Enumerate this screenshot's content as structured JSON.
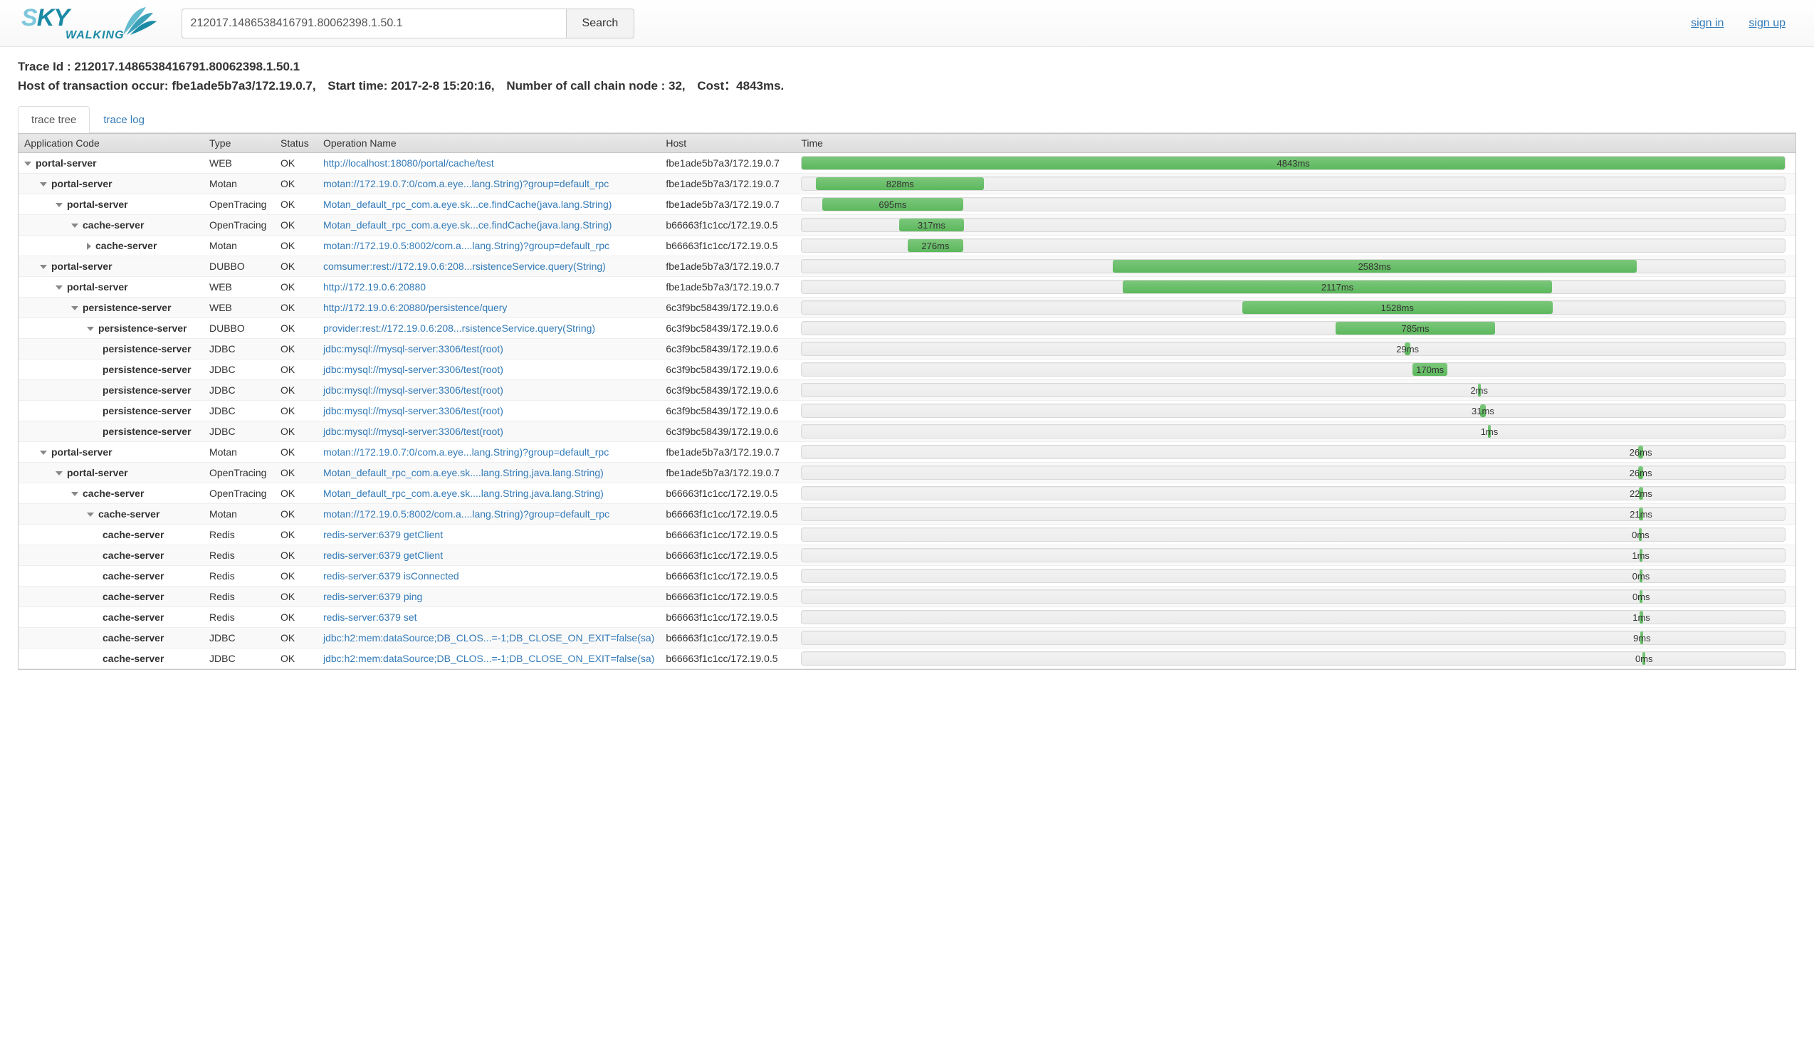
{
  "logo": {
    "main": "SKY",
    "sub": "WALKING"
  },
  "search": {
    "value": "212017.1486538416791.80062398.1.50.1",
    "button": "Search"
  },
  "toplinks": {
    "signin": "sign in",
    "signup": "sign up"
  },
  "meta": {
    "trace_label": "Trace Id : ",
    "trace_id": "212017.1486538416791.80062398.1.50.1",
    "host_label": "Host of transaction occur: ",
    "host": "fbe1ade5b7a3/172.19.0.7,",
    "start_label": "Start time: ",
    "start": "2017-2-8 15:20:16,",
    "nodes_label": "Number of call chain node : ",
    "nodes": "32,",
    "cost_label": "Cost：",
    "cost": "4843ms."
  },
  "tabs": {
    "tree": "trace tree",
    "log": "trace log"
  },
  "columns": {
    "app": "Application Code",
    "type": "Type",
    "status": "Status",
    "op": "Operation Name",
    "host": "Host",
    "time": "Time"
  },
  "total_ms": 4843,
  "rows": [
    {
      "indent": 0,
      "caret": "down",
      "app": "portal-server",
      "type": "WEB",
      "status": "OK",
      "op": "http://localhost:18080/portal/cache/test",
      "host": "fbe1ade5b7a3/172.19.0.7",
      "offset": 0,
      "dur": 4843
    },
    {
      "indent": 1,
      "caret": "down",
      "app": "portal-server",
      "type": "Motan",
      "status": "OK",
      "op": "motan://172.19.0.7:0/com.a.eye...lang.String)?group=default_rpc",
      "host": "fbe1ade5b7a3/172.19.0.7",
      "offset": 70,
      "dur": 828
    },
    {
      "indent": 2,
      "caret": "down",
      "app": "portal-server",
      "type": "OpenTracing",
      "status": "OK",
      "op": "Motan_default_rpc_com.a.eye.sk...ce.findCache(java.lang.String)",
      "host": "fbe1ade5b7a3/172.19.0.7",
      "offset": 100,
      "dur": 695
    },
    {
      "indent": 3,
      "caret": "down",
      "app": "cache-server",
      "type": "OpenTracing",
      "status": "OK",
      "op": "Motan_default_rpc_com.a.eye.sk...ce.findCache(java.lang.String)",
      "host": "b66663f1c1cc/172.19.0.5",
      "offset": 480,
      "dur": 317
    },
    {
      "indent": 4,
      "caret": "right",
      "app": "cache-server",
      "type": "Motan",
      "status": "OK",
      "op": "motan://172.19.0.5:8002/com.a....lang.String)?group=default_rpc",
      "host": "b66663f1c1cc/172.19.0.5",
      "offset": 520,
      "dur": 276
    },
    {
      "indent": 1,
      "caret": "down",
      "app": "portal-server",
      "type": "DUBBO",
      "status": "OK",
      "op": "comsumer:rest://172.19.0.6:208...rsistenceService.query(String)",
      "host": "fbe1ade5b7a3/172.19.0.7",
      "offset": 1530,
      "dur": 2583
    },
    {
      "indent": 2,
      "caret": "down",
      "app": "portal-server",
      "type": "WEB",
      "status": "OK",
      "op": "http://172.19.0.6:20880",
      "host": "fbe1ade5b7a3/172.19.0.7",
      "offset": 1580,
      "dur": 2117
    },
    {
      "indent": 3,
      "caret": "down",
      "app": "persistence-server",
      "type": "WEB",
      "status": "OK",
      "op": "http://172.19.0.6:20880/persistence/query",
      "host": "6c3f9bc58439/172.19.0.6",
      "offset": 2170,
      "dur": 1528
    },
    {
      "indent": 4,
      "caret": "down",
      "app": "persistence-server",
      "type": "DUBBO",
      "status": "OK",
      "op": "provider:rest://172.19.0.6:208...rsistenceService.query(String)",
      "host": "6c3f9bc58439/172.19.0.6",
      "offset": 2630,
      "dur": 785
    },
    {
      "indent": 5,
      "caret": "",
      "app": "persistence-server",
      "type": "JDBC",
      "status": "OK",
      "op": "jdbc:mysql://mysql-server:3306/test(root)",
      "host": "6c3f9bc58439/172.19.0.6",
      "offset": 2970,
      "dur": 29
    },
    {
      "indent": 5,
      "caret": "",
      "app": "persistence-server",
      "type": "JDBC",
      "status": "OK",
      "op": "jdbc:mysql://mysql-server:3306/test(root)",
      "host": "6c3f9bc58439/172.19.0.6",
      "offset": 3010,
      "dur": 170
    },
    {
      "indent": 5,
      "caret": "",
      "app": "persistence-server",
      "type": "JDBC",
      "status": "OK",
      "op": "jdbc:mysql://mysql-server:3306/test(root)",
      "host": "6c3f9bc58439/172.19.0.6",
      "offset": 3330,
      "dur": 2
    },
    {
      "indent": 5,
      "caret": "",
      "app": "persistence-server",
      "type": "JDBC",
      "status": "OK",
      "op": "jdbc:mysql://mysql-server:3306/test(root)",
      "host": "6c3f9bc58439/172.19.0.6",
      "offset": 3340,
      "dur": 31
    },
    {
      "indent": 5,
      "caret": "",
      "app": "persistence-server",
      "type": "JDBC",
      "status": "OK",
      "op": "jdbc:mysql://mysql-server:3306/test(root)",
      "host": "6c3f9bc58439/172.19.0.6",
      "offset": 3380,
      "dur": 1
    },
    {
      "indent": 1,
      "caret": "down",
      "app": "portal-server",
      "type": "Motan",
      "status": "OK",
      "op": "motan://172.19.0.7:0/com.a.eye...lang.String)?group=default_rpc",
      "host": "fbe1ade5b7a3/172.19.0.7",
      "offset": 4120,
      "dur": 26
    },
    {
      "indent": 2,
      "caret": "down",
      "app": "portal-server",
      "type": "OpenTracing",
      "status": "OK",
      "op": "Motan_default_rpc_com.a.eye.sk....lang.String,java.lang.String)",
      "host": "fbe1ade5b7a3/172.19.0.7",
      "offset": 4120,
      "dur": 26
    },
    {
      "indent": 3,
      "caret": "down",
      "app": "cache-server",
      "type": "OpenTracing",
      "status": "OK",
      "op": "Motan_default_rpc_com.a.eye.sk....lang.String,java.lang.String)",
      "host": "b66663f1c1cc/172.19.0.5",
      "offset": 4123,
      "dur": 22
    },
    {
      "indent": 4,
      "caret": "down",
      "app": "cache-server",
      "type": "Motan",
      "status": "OK",
      "op": "motan://172.19.0.5:8002/com.a....lang.String)?group=default_rpc",
      "host": "b66663f1c1cc/172.19.0.5",
      "offset": 4124,
      "dur": 21
    },
    {
      "indent": 5,
      "caret": "",
      "app": "cache-server",
      "type": "Redis",
      "status": "OK",
      "op": "redis-server:6379 getClient",
      "host": "b66663f1c1cc/172.19.0.5",
      "offset": 4125,
      "dur": 0
    },
    {
      "indent": 5,
      "caret": "",
      "app": "cache-server",
      "type": "Redis",
      "status": "OK",
      "op": "redis-server:6379 getClient",
      "host": "b66663f1c1cc/172.19.0.5",
      "offset": 4126,
      "dur": 1
    },
    {
      "indent": 5,
      "caret": "",
      "app": "cache-server",
      "type": "Redis",
      "status": "OK",
      "op": "redis-server:6379 isConnected",
      "host": "b66663f1c1cc/172.19.0.5",
      "offset": 4127,
      "dur": 0
    },
    {
      "indent": 5,
      "caret": "",
      "app": "cache-server",
      "type": "Redis",
      "status": "OK",
      "op": "redis-server:6379 ping",
      "host": "b66663f1c1cc/172.19.0.5",
      "offset": 4128,
      "dur": 0
    },
    {
      "indent": 5,
      "caret": "",
      "app": "cache-server",
      "type": "Redis",
      "status": "OK",
      "op": "redis-server:6379 set",
      "host": "b66663f1c1cc/172.19.0.5",
      "offset": 4129,
      "dur": 1
    },
    {
      "indent": 5,
      "caret": "",
      "app": "cache-server",
      "type": "JDBC",
      "status": "OK",
      "op": "jdbc:h2:mem:dataSource;DB_CLOS...=-1;DB_CLOSE_ON_EXIT=false(sa)",
      "host": "b66663f1c1cc/172.19.0.5",
      "offset": 4132,
      "dur": 9
    },
    {
      "indent": 5,
      "caret": "",
      "app": "cache-server",
      "type": "JDBC",
      "status": "OK",
      "op": "jdbc:h2:mem:dataSource;DB_CLOS...=-1;DB_CLOSE_ON_EXIT=false(sa)",
      "host": "b66663f1c1cc/172.19.0.5",
      "offset": 4142,
      "dur": 0
    }
  ]
}
